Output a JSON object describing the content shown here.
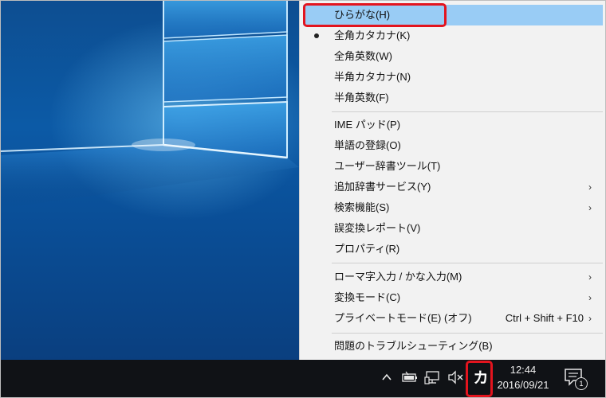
{
  "menu": {
    "items": [
      {
        "label": "ひらがな(H)",
        "shortcut": "",
        "submenu": false,
        "checked": false
      },
      {
        "label": "全角カタカナ(K)",
        "shortcut": "",
        "submenu": false,
        "checked": true
      },
      {
        "label": "全角英数(W)",
        "shortcut": "",
        "submenu": false,
        "checked": false
      },
      {
        "label": "半角カタカナ(N)",
        "shortcut": "",
        "submenu": false,
        "checked": false
      },
      {
        "label": "半角英数(F)",
        "shortcut": "",
        "submenu": false,
        "checked": false
      },
      {
        "label": "IME パッド(P)",
        "shortcut": "",
        "submenu": false,
        "checked": false
      },
      {
        "label": "単語の登録(O)",
        "shortcut": "",
        "submenu": false,
        "checked": false
      },
      {
        "label": "ユーザー辞書ツール(T)",
        "shortcut": "",
        "submenu": false,
        "checked": false
      },
      {
        "label": "追加辞書サービス(Y)",
        "shortcut": "",
        "submenu": true,
        "checked": false
      },
      {
        "label": "検索機能(S)",
        "shortcut": "",
        "submenu": true,
        "checked": false
      },
      {
        "label": "誤変換レポート(V)",
        "shortcut": "",
        "submenu": false,
        "checked": false
      },
      {
        "label": "プロパティ(R)",
        "shortcut": "",
        "submenu": false,
        "checked": false
      },
      {
        "label": "ローマ字入力 / かな入力(M)",
        "shortcut": "",
        "submenu": true,
        "checked": false
      },
      {
        "label": "変換モード(C)",
        "shortcut": "",
        "submenu": true,
        "checked": false
      },
      {
        "label": "プライベートモード(E) (オフ)",
        "shortcut": "Ctrl + Shift + F10",
        "submenu": true,
        "checked": false
      },
      {
        "label": "問題のトラブルシューティング(B)",
        "shortcut": "",
        "submenu": false,
        "checked": false
      }
    ],
    "submenu_arrow": "›"
  },
  "taskbar": {
    "ime_mode": "カ",
    "time": "12:44",
    "date": "2016/09/21",
    "notification_count": "1",
    "icons": [
      "chevron-up-icon",
      "battery-icon",
      "network-icon",
      "volume-mute-icon",
      "action-center-icon"
    ]
  },
  "colors": {
    "highlight": "#99ccf5",
    "callout": "#e3141e",
    "taskbar": "#101216",
    "menu_bg": "#f2f2f2"
  }
}
